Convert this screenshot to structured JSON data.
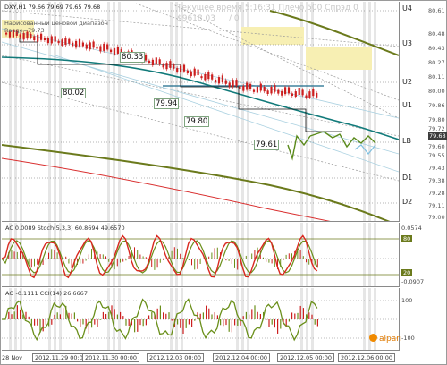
{
  "header": {
    "symbol_line": "DXY,H1  79.66 79.69 79.65 79.68",
    "server_time": "Текущее время 5:16:31 Плечо 500 Спрэд 0",
    "balance": "$9618.03",
    "balance_value": "/ 0"
  },
  "range_label": {
    "line1": "Нарисованный ценовой диапазон",
    "line2": "Range=79.73"
  },
  "price_labels": [
    "80.33",
    "80.02",
    "79.94",
    "79.80",
    "79.61"
  ],
  "levels": [
    "U4",
    "U3",
    "U2",
    "U1",
    "LB",
    "D1",
    "D2"
  ],
  "price_axis": {
    "ticks": [
      "80.61",
      "80.48",
      "80.43",
      "80.27",
      "80.11",
      "80.00",
      "79.86",
      "79.80",
      "79.72",
      "79.60",
      "79.55",
      "79.43",
      "79.38",
      "79.28",
      "79.11",
      "79.00"
    ],
    "current_price": "79.68"
  },
  "stoch": {
    "title": "AC 0.0089  Stoch(5,3,3) 60.8694 49.6570",
    "scale_top": "0.0574",
    "scale_80": "80",
    "scale_20": "20",
    "scale_bottom": "-0.0907"
  },
  "cci": {
    "title": "AO -0.1111  CCI(14) 26.6667",
    "scale_top": "100",
    "scale_bottom": "-100"
  },
  "time_axis": {
    "labels": [
      "28 Nov",
      "2012.11.29 00:00",
      "2012.11.30 00:00",
      "2012.12.03 00:00",
      "2012.12.04 00:00",
      "2012.12.05 00:00",
      "2012.12.06 00:00"
    ]
  },
  "logo": {
    "text": "alpari"
  },
  "colors": {
    "candle": "#cc1f1f",
    "teal_ma": "#117a7a",
    "olive_ma": "#6b7a1c",
    "red_ma": "#d93030",
    "stoch_main": "#d9281f",
    "stoch_signal": "#6a8f1a",
    "zone": "#f7efb3"
  }
}
